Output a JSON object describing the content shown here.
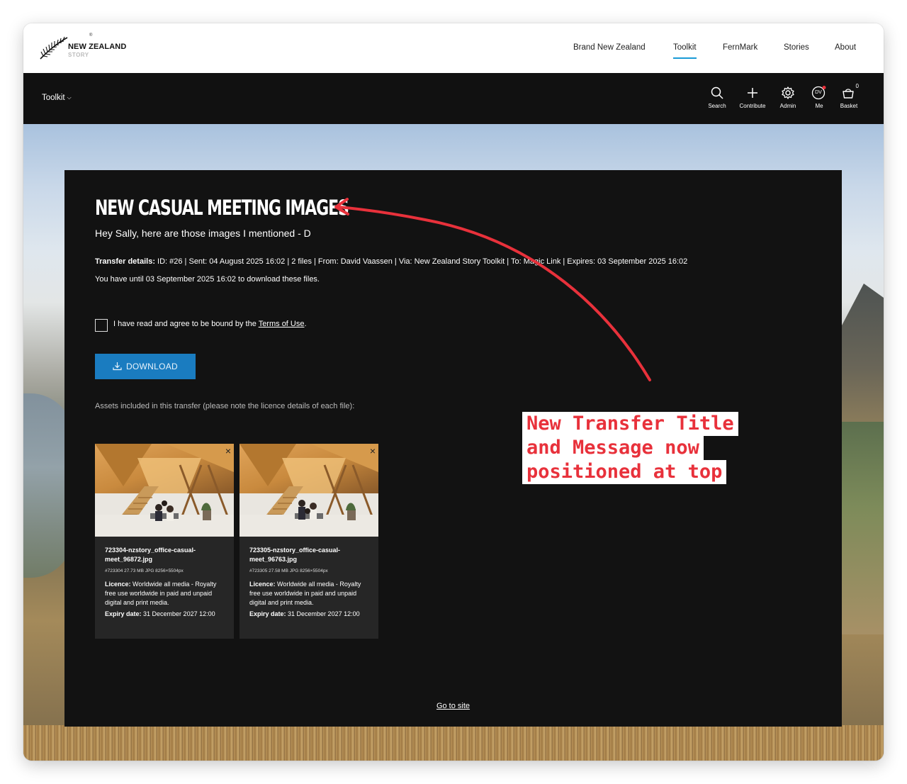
{
  "header": {
    "logo_line1": "NEW ZEALAND",
    "logo_line2": "STORY",
    "logo_reg": "®",
    "nav": [
      "Brand New Zealand",
      "Toolkit",
      "FernMark",
      "Stories",
      "About"
    ],
    "active_nav": "Toolkit",
    "accent_color": "#1a9ad6"
  },
  "toolbar": {
    "menu_label": "Toolkit",
    "tools": [
      {
        "label": "Search",
        "icon": "search-icon"
      },
      {
        "label": "Contribute",
        "icon": "plus-icon"
      },
      {
        "label": "Admin",
        "icon": "gear-icon"
      },
      {
        "label": "Me",
        "icon": "avatar-icon",
        "initials": "DV"
      },
      {
        "label": "Basket",
        "icon": "basket-icon",
        "count": "0"
      }
    ]
  },
  "transfer": {
    "title": "NEW CASUAL MEETING IMAGES",
    "message": "Hey Sally, here are those images I mentioned - D",
    "details_label": "Transfer details:",
    "details_text": " ID: #26 | Sent: 04 August 2025 16:02 | 2 files | From: David Vaassen | Via: New Zealand Story Toolkit | To: Magic Link | Expires: 03 September 2025 16:02",
    "until_text": "You have until 03 September 2025 16:02 to download these files.",
    "agree_prefix": "I have read and agree to be bound by the ",
    "agree_link": "Terms of Use",
    "agree_suffix": ".",
    "download_label": "DOWNLOAD",
    "download_color": "#1a7cc0",
    "assets_note": "Assets included in this transfer (please note the licence details of each file):",
    "goto_label": "Go to site"
  },
  "assets": [
    {
      "filename": "723304-nzstory_office-casual-meet_96872.jpg",
      "meta": "#723304 27.73 MB JPG 8256×5504px",
      "licence_label": "Licence:",
      "licence_text": " Worldwide all media - Royalty free use worldwide in paid and unpaid digital and print media.",
      "expiry_label": "Expiry date:",
      "expiry_text": " 31 December 2027 12:00",
      "remove": "×"
    },
    {
      "filename": "723305-nzstory_office-casual-meet_96763.jpg",
      "meta": "#723305 27.58 MB JPG 8256×5504px",
      "licence_label": "Licence:",
      "licence_text": " Worldwide all media - Royalty free use worldwide in paid and unpaid digital and print media.",
      "expiry_label": "Expiry date:",
      "expiry_text": " 31 December 2027 12:00",
      "remove": "×"
    }
  ],
  "annotation": {
    "lines": [
      "New Transfer Title",
      "and Message now",
      "positioned at top"
    ],
    "color": "#e8313b"
  }
}
